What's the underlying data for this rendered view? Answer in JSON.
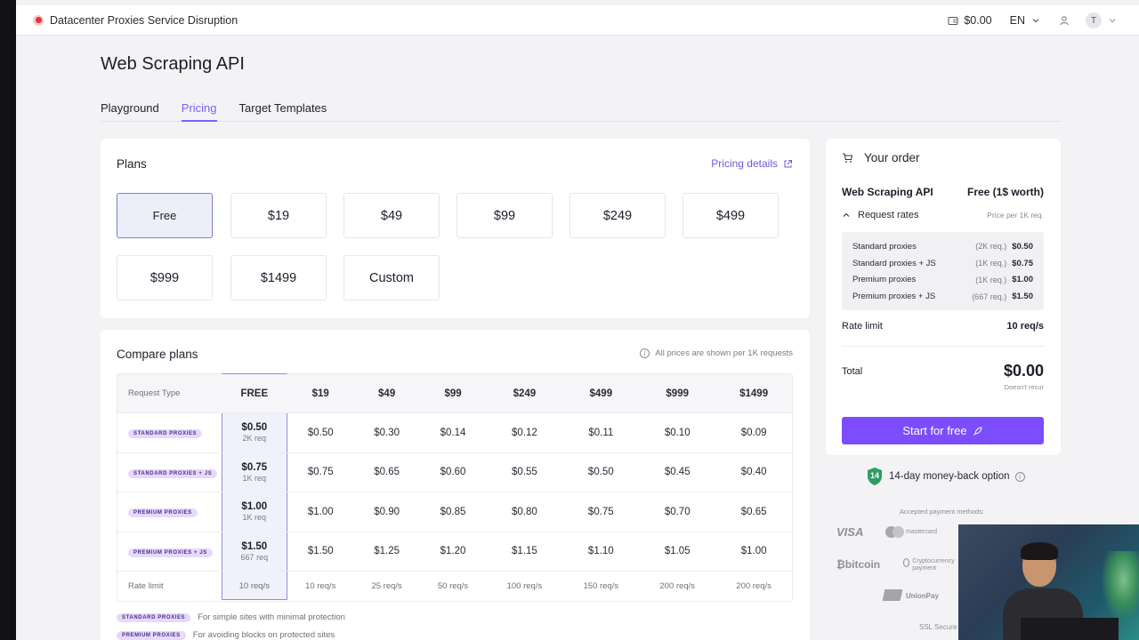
{
  "alert": {
    "text": "Datacenter Proxies Service Disruption"
  },
  "topbar": {
    "balance": "$0.00",
    "language": "EN",
    "avatar_letter": "T"
  },
  "page_title": "Web Scraping API",
  "tabs": [
    {
      "label": "Playground"
    },
    {
      "label": "Pricing"
    },
    {
      "label": "Target Templates"
    }
  ],
  "plans": {
    "title": "Plans",
    "pricing_details": "Pricing details",
    "options": [
      "Free",
      "$19",
      "$49",
      "$99",
      "$249",
      "$499",
      "$999",
      "$1499",
      "Custom"
    ],
    "selected": "Free"
  },
  "compare": {
    "title": "Compare plans",
    "note": "All prices are shown per 1K requests",
    "header": [
      "Request Type",
      "FREE",
      "$19",
      "$49",
      "$99",
      "$249",
      "$499",
      "$999",
      "$1499"
    ],
    "rows": [
      {
        "type": "STANDARD PROXIES",
        "free_price": "$0.50",
        "free_req": "2K req",
        "prices": [
          "$0.50",
          "$0.30",
          "$0.14",
          "$0.12",
          "$0.11",
          "$0.10",
          "$0.09"
        ]
      },
      {
        "type": "STANDARD PROXIES + JS",
        "free_price": "$0.75",
        "free_req": "1K req",
        "prices": [
          "$0.75",
          "$0.65",
          "$0.60",
          "$0.55",
          "$0.50",
          "$0.45",
          "$0.40"
        ]
      },
      {
        "type": "PREMIUM PROXIES",
        "free_price": "$1.00",
        "free_req": "1K req",
        "prices": [
          "$1.00",
          "$0.90",
          "$0.85",
          "$0.80",
          "$0.75",
          "$0.70",
          "$0.65"
        ]
      },
      {
        "type": "PREMIUM PROXIES + JS",
        "free_price": "$1.50",
        "free_req": "667 req",
        "prices": [
          "$1.50",
          "$1.25",
          "$1.20",
          "$1.15",
          "$1.10",
          "$1.05",
          "$1.00"
        ]
      }
    ],
    "rate_limit": {
      "label": "Rate limit",
      "values": [
        "10 req/s",
        "10 req/s",
        "25 req/s",
        "50 req/s",
        "100 req/s",
        "150 req/s",
        "200 req/s",
        "200 req/s"
      ]
    },
    "legend": [
      {
        "pill": "STANDARD PROXIES",
        "text": "For simple sites with minimal protection"
      },
      {
        "pill": "PREMIUM PROXIES",
        "text": "For avoiding blocks on protected sites"
      }
    ]
  },
  "order": {
    "title": "Your order",
    "product": "Web Scraping API",
    "product_price": "Free (1$ worth)",
    "request_rates_label": "Request rates",
    "price_per": "Price per 1K req.",
    "rates": [
      {
        "name": "Standard proxies",
        "req": "(2K req.)",
        "price": "$0.50"
      },
      {
        "name": "Standard proxies + JS",
        "req": "(1K req.)",
        "price": "$0.75"
      },
      {
        "name": "Premium proxies",
        "req": "(1K req.)",
        "price": "$1.00"
      },
      {
        "name": "Premium proxies + JS",
        "req": "(667 req.)",
        "price": "$1.50"
      }
    ],
    "rate_limit_label": "Rate limit",
    "rate_limit_value": "10 req/s",
    "total_label": "Total",
    "total_value": "$0.00",
    "recur_note": "Doesn't recur",
    "cta": "Start for free"
  },
  "money_back": {
    "days": "14",
    "text": "14-day money-back option"
  },
  "payments": {
    "label": "Accepted payment methods:",
    "visa": "VISA",
    "mastercard": "mastercard",
    "bitcoin": "bitcoin",
    "crypto": "Cryptocurrency payment",
    "unionpay": "UnionPay",
    "ssl": "SSL Secure P"
  },
  "colors": {
    "accent": "#7b4dfc",
    "tab_active": "#7b61ff",
    "alert": "#e4343e",
    "pill_bg": "#e7d9fb"
  }
}
